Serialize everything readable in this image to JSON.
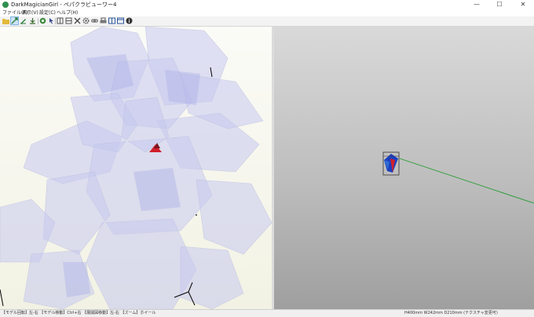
{
  "window": {
    "title": "DarkMagicianGirl - ペパクラビューワー4",
    "minimize_glyph": "—",
    "maximize_glyph": "☐",
    "close_glyph": "✕"
  },
  "menu": {
    "items": [
      "ファイル(F)",
      "表示(V)",
      "設定(C)",
      "ヘルプ(H)"
    ]
  },
  "toolbar": {
    "icons": [
      "open-folder-icon",
      "3d-move-icon",
      "2d-edit-icon",
      "export-icon",
      "texture-icon",
      "select-icon",
      "unfold-icon",
      "fold-icon",
      "cut-icon",
      "gear-icon",
      "link-icon",
      "print-icon",
      "split-view-icon",
      "window-icon",
      "info-icon"
    ],
    "active_index": 1
  },
  "status": {
    "left": "【モデル回転】左-右 【モデル移動】Ctrl+右 【展開図移動】左-右 【ズーム】ホイール",
    "right": "H400mm W242mm D210mm (テクスチャ変更可)"
  },
  "colors": {
    "accent_red": "#d11f2b",
    "accent_blue": "#1c3fbf",
    "guide_green": "#1f9b2e"
  }
}
